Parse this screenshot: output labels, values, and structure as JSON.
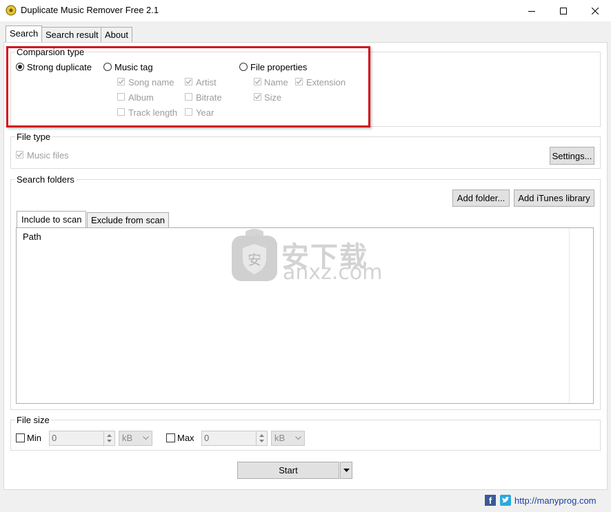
{
  "window": {
    "title": "Duplicate Music Remover Free 2.1"
  },
  "tabs": [
    "Search",
    "Search result",
    "About"
  ],
  "comparison": {
    "label": "Comparsion type",
    "options": [
      "Strong duplicate",
      "Music tag",
      "File properties"
    ],
    "selected": "Strong duplicate",
    "music_tag_fields": [
      "Song name",
      "Artist",
      "Album",
      "Bitrate",
      "Track length",
      "Year"
    ],
    "file_property_fields": [
      "Name",
      "Extension",
      "Size"
    ]
  },
  "file_type": {
    "label": "File type",
    "music_files": "Music files",
    "settings": "Settings..."
  },
  "search_folders": {
    "label": "Search folders",
    "add_folder": "Add folder...",
    "add_itunes": "Add iTunes library",
    "tabs": [
      "Include to scan",
      "Exclude from scan"
    ],
    "column": "Path"
  },
  "file_size": {
    "label": "File size",
    "min_label": "Min",
    "min_value": "0",
    "min_unit": "kB",
    "max_label": "Max",
    "max_value": "0",
    "max_unit": "kB"
  },
  "start": "Start",
  "watermark": {
    "cn": "安下载",
    "site": "anxz.com"
  },
  "footer": {
    "link": "http://manyprog.com"
  },
  "colors": {
    "highlight_border": "#d3121a",
    "facebook": "#3b5998",
    "twitter": "#2aa9e0"
  }
}
